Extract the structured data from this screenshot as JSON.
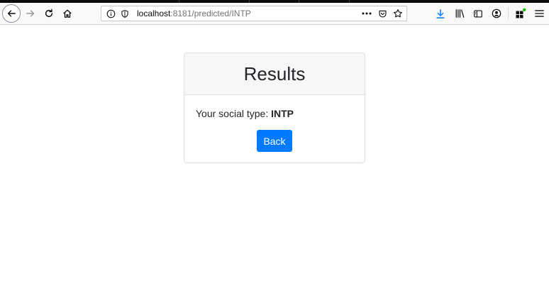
{
  "browser": {
    "url_host": "localhost",
    "url_rest": ":8181/predicted/INTP",
    "icons": {
      "back": "arrow-left-icon",
      "forward": "arrow-right-icon",
      "reload": "reload-icon",
      "home": "home-icon",
      "info": "info-icon",
      "tracking": "shield-icon",
      "more": "more-dots-icon",
      "pocket": "pocket-icon",
      "bookmark": "star-icon",
      "downloads": "download-icon",
      "library": "library-icon",
      "sidebar": "sidebar-icon",
      "account": "account-icon",
      "extensions": "extensions-icon",
      "menu": "hamburger-menu-icon"
    },
    "colors": {
      "download_accent": "#0a84ff"
    }
  },
  "page": {
    "card_title": "Results",
    "result_label": "Your social type: ",
    "result_value": "INTP",
    "back_button": "Back",
    "colors": {
      "button": "#007bff"
    }
  }
}
